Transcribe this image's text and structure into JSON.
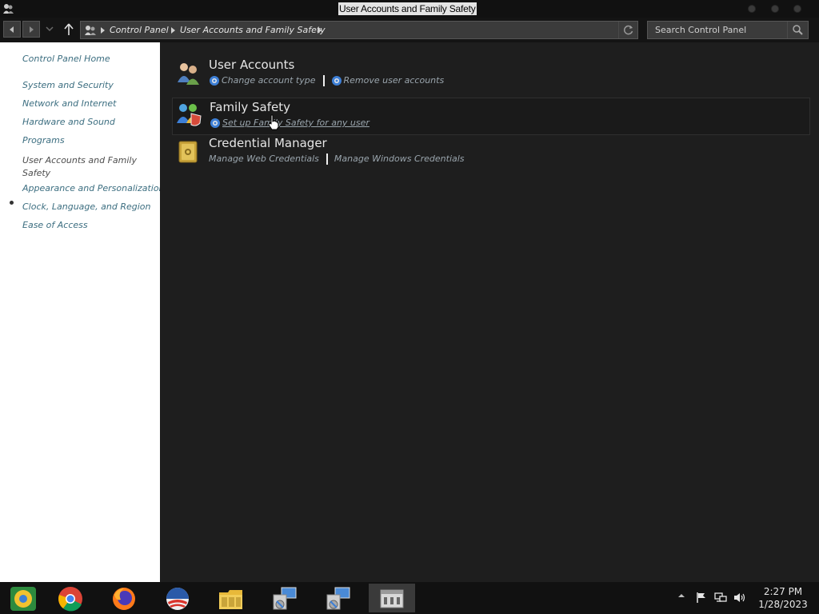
{
  "window": {
    "title": "User Accounts and Family Safety"
  },
  "nav": {
    "breadcrumbs": [
      "Control Panel",
      "User Accounts and Family Safety"
    ],
    "search_placeholder": "Search Control Panel"
  },
  "sidebar": {
    "home": "Control Panel Home",
    "items": [
      "System and Security",
      "Network and Internet",
      "Hardware and Sound",
      "Programs",
      "User Accounts and Family Safety",
      "Appearance and Personalization",
      "Clock, Language, and Region",
      "Ease of Access"
    ],
    "current_index": 4
  },
  "categories": [
    {
      "title": "User Accounts",
      "icon": "user-accounts-icon",
      "links": [
        "Change account type",
        "Remove user accounts"
      ]
    },
    {
      "title": "Family Safety",
      "icon": "family-safety-icon",
      "links": [
        "Set up Family Safety for any user"
      ]
    },
    {
      "title": "Credential Manager",
      "icon": "credential-manager-icon",
      "links": [
        "Manage Web Credentials",
        "Manage Windows Credentials"
      ]
    }
  ],
  "taskbar": {
    "apps": [
      "chrome-canary-icon",
      "chrome-icon",
      "firefox-icon",
      "obama-logo-icon",
      "file-explorer-icon",
      "computer-network-icon",
      "computer-network-icon",
      "control-panel-icon"
    ],
    "clock": {
      "time": "2:27 PM",
      "date": "1/28/2023"
    }
  },
  "colors": {
    "accent_link": "#3c6e80",
    "content_bg": "#1e1e1e",
    "sidebar_bg": "#ffffff"
  }
}
